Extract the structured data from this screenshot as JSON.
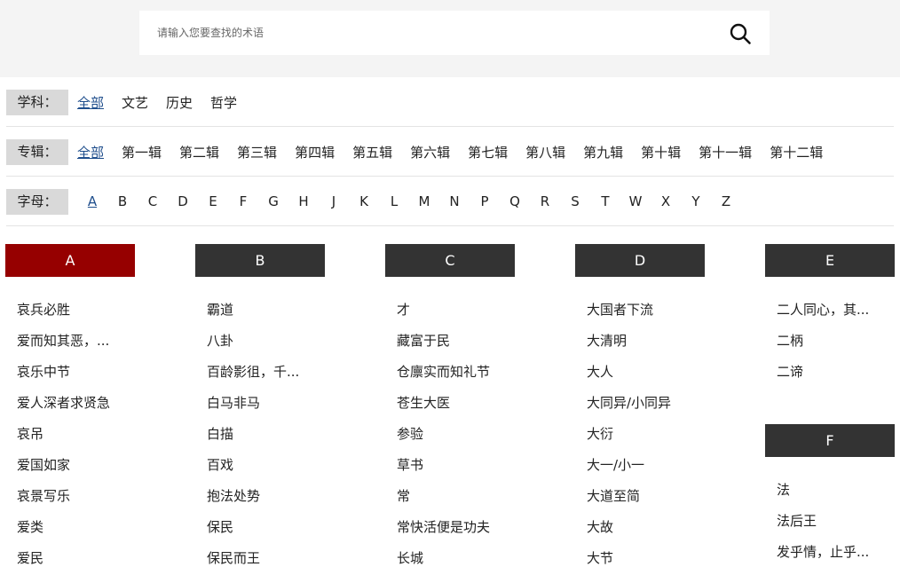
{
  "search": {
    "placeholder": "请输入您要查找的术语",
    "icon": "search-icon"
  },
  "filters": {
    "subject": {
      "label": "学科：",
      "options": [
        "全部",
        "文艺",
        "历史",
        "哲学"
      ],
      "active": "全部"
    },
    "volume": {
      "label": "专辑：",
      "options": [
        "全部",
        "第一辑",
        "第二辑",
        "第三辑",
        "第四辑",
        "第五辑",
        "第六辑",
        "第七辑",
        "第八辑",
        "第九辑",
        "第十辑",
        "第十一辑",
        "第十二辑"
      ],
      "active": "全部"
    },
    "letter": {
      "label": "字母：",
      "options": [
        "A",
        "B",
        "C",
        "D",
        "E",
        "F",
        "G",
        "H",
        "J",
        "K",
        "L",
        "M",
        "N",
        "P",
        "Q",
        "R",
        "S",
        "T",
        "W",
        "X",
        "Y",
        "Z"
      ],
      "active": "A"
    }
  },
  "colors": {
    "active_header": "#960000",
    "header": "#333333",
    "active_link": "#1f4e8c"
  },
  "columns": [
    {
      "letter": "A",
      "terms": [
        "哀兵必胜",
        "爱而知其恶，...",
        "哀乐中节",
        "爱人深者求贤急",
        "哀吊",
        "爱国如家",
        "哀景写乐",
        "爱类",
        "爱民"
      ]
    },
    {
      "letter": "B",
      "terms": [
        "霸道",
        "八卦",
        "百龄影徂，千...",
        "白马非马",
        "白描",
        "百戏",
        "抱法处势",
        "保民",
        "保民而王"
      ]
    },
    {
      "letter": "C",
      "terms": [
        "才",
        "藏富于民",
        "仓廪实而知礼节",
        "苍生大医",
        "参验",
        "草书",
        "常",
        "常快活便是功夫",
        "长城"
      ]
    },
    {
      "letter": "D",
      "terms": [
        "大国者下流",
        "大清明",
        "大人",
        "大同异/小同异",
        "大衍",
        "大一/小一",
        "大道至简",
        "大故",
        "大节"
      ]
    },
    {
      "letter": "E",
      "terms": [
        "二人同心，其...",
        "二柄",
        "二谛"
      ]
    },
    {
      "letter": "F",
      "terms": [
        "法",
        "法后王",
        "发乎情，止乎..."
      ]
    }
  ]
}
